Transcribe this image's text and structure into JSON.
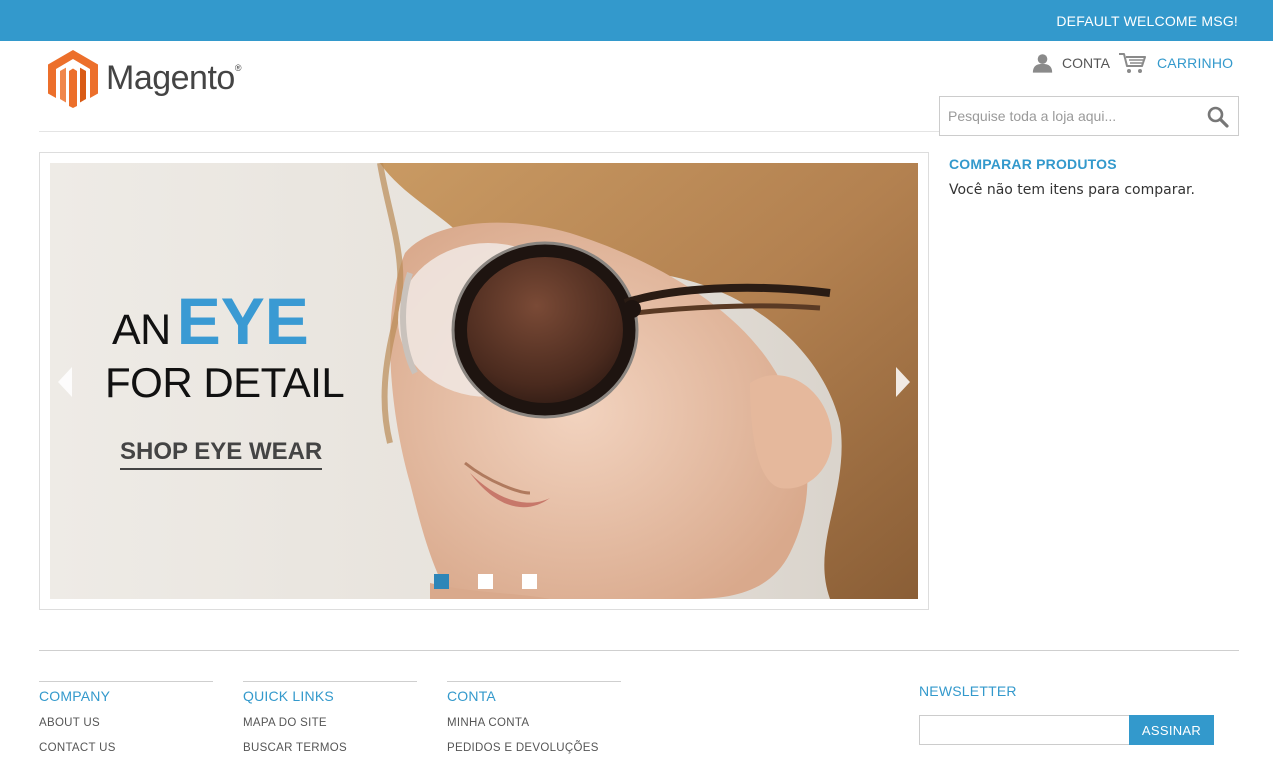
{
  "colors": {
    "accent": "#3399cc",
    "logo_orange": "#ec6f2b",
    "active_dot": "#2e86b8"
  },
  "topbar": {
    "welcome_msg": "DEFAULT WELCOME MSG!"
  },
  "header": {
    "logo_text": "Magento",
    "logo_reg": "®",
    "account_label": "CONTA",
    "account_icon": "user-icon",
    "cart_label": "CARRINHO",
    "cart_icon": "cart-icon"
  },
  "search": {
    "placeholder": "Pesquise toda a loja aqui...",
    "value": "",
    "icon": "search-icon"
  },
  "banner": {
    "line1_prefix": "AN",
    "line1_highlight": "EYE",
    "line2": "FOR DETAIL",
    "cta": "SHOP EYE WEAR",
    "prev_icon": "chevron-left-icon",
    "next_icon": "chevron-right-icon",
    "slide_count": 3,
    "active_slide": 1
  },
  "compare": {
    "title": "COMPARAR PRODUTOS",
    "empty_msg": "Você não tem itens para comparar."
  },
  "footer": {
    "columns": [
      {
        "title": "COMPANY",
        "links": [
          "ABOUT US",
          "CONTACT US"
        ]
      },
      {
        "title": "QUICK LINKS",
        "links": [
          "MAPA DO SITE",
          "BUSCAR TERMOS"
        ]
      },
      {
        "title": "CONTA",
        "links": [
          "MINHA CONTA",
          "PEDIDOS E DEVOLUÇÕES"
        ]
      }
    ],
    "newsletter": {
      "title": "NEWSLETTER",
      "input_value": "",
      "button_label": "ASSINAR"
    }
  }
}
